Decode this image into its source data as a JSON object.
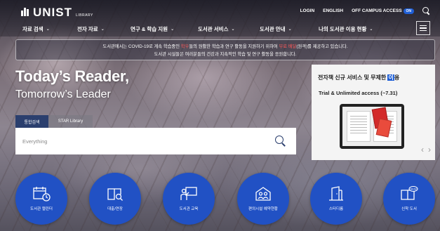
{
  "header": {
    "logo_word": "UNIST",
    "logo_sub": "LIBRARY",
    "utility": {
      "login": "LOGIN",
      "english": "ENGLISH",
      "off_campus": "OFF CAMPUS ACCESS",
      "toggle": "ON"
    },
    "gnb": [
      {
        "label": "자료 검색"
      },
      {
        "label": "전자 자료"
      },
      {
        "label": "연구 & 학습 지원"
      },
      {
        "label": "도서관 서비스"
      },
      {
        "label": "도서관 안내"
      },
      {
        "label": "나의 도서관 이용 현황"
      }
    ]
  },
  "notice": {
    "line1_a": "도서관에서는 COVID-19로 계속 학습중인 ",
    "line1_hl": "학우",
    "line1_b": "들의 원활한 학습과 연구 활동을 지원하기 위하여 ",
    "line1_hl2": "무료 배달",
    "line1_c": "(원격)를 제공하고 있습니다.",
    "line2": "도서관 시설들은 여러분들의 건강과 지속적인 학습 및 연구 활동을 응원합니다."
  },
  "hero": {
    "title": "Today’s Reader,",
    "subtitle": "Tomorrow’s Leader"
  },
  "search": {
    "tabs": [
      "통합검색",
      "STAR Library"
    ],
    "placeholder": "Everything"
  },
  "banner": {
    "title_a": "전자책 신규 서비스 및 무제한 ",
    "title_boxed": "이",
    "title_b": "용",
    "subtitle": "Trial & Unlimited access (~7.31)",
    "prev": "‹",
    "next": "›"
  },
  "quick_links": [
    {
      "label": "도서관 캘린더",
      "icon": "calendar-clock-icon"
    },
    {
      "label": "대출/연장",
      "icon": "book-search-icon"
    },
    {
      "label": "도서관 교육",
      "icon": "teacher-board-icon"
    },
    {
      "label": "편의시설 예약현황",
      "icon": "people-room-icon"
    },
    {
      "label": "스터디룸",
      "icon": "door-room-icon"
    },
    {
      "label": "신착 도서",
      "icon": "new-book-icon",
      "badge": "NEW"
    }
  ],
  "colors": {
    "accent": "#2151c4",
    "search_tab": "#2b3f6e",
    "toggle": "#1f5fd6",
    "highlight": "#ff5a5a"
  }
}
